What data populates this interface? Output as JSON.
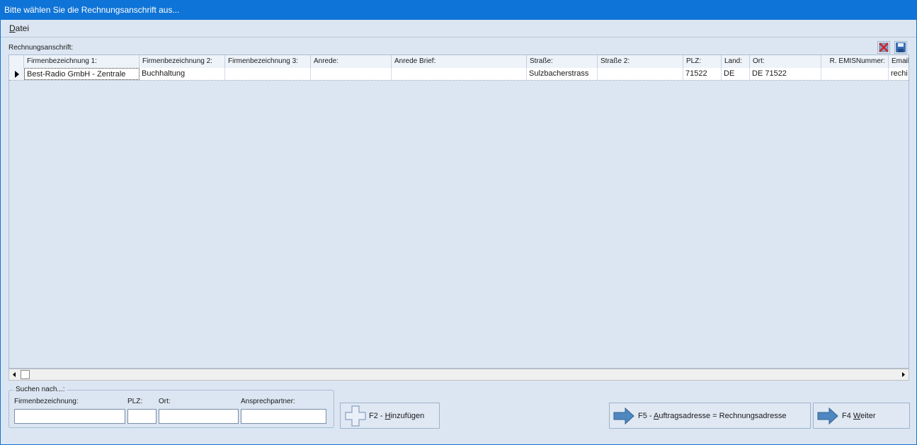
{
  "window": {
    "title": "Bitte wählen Sie die Rechnungsanschrift aus..."
  },
  "menu": {
    "datei": {
      "label_u": "D",
      "label_rest": "atei"
    }
  },
  "section": {
    "label": "Rechnungsanschrift:"
  },
  "grid": {
    "columns": [
      "Firmenbezeichnung 1:",
      "Firmenbezeichnung 2:",
      "Firmenbezeichnung 3:",
      "Anrede:",
      "Anrede Brief:",
      "Straße:",
      "Straße 2:",
      "PLZ:",
      "Land:",
      "Ort:",
      "R. EMISNummer:",
      "Email"
    ],
    "rows": [
      {
        "firma1": "Best-Radio GmbH - Zentrale",
        "firma2": "Buchhaltung",
        "firma3": "",
        "anrede": "",
        "anrede_brief": "",
        "strasse": "Sulzbacherstrass",
        "strasse2": "",
        "plz": "71522",
        "land": "DE",
        "ort": "DE 71522",
        "emis": "",
        "email": "rechi"
      }
    ]
  },
  "search": {
    "legend": "Suchen nach...:",
    "firma_label": "Firmenbezeichnung:",
    "plz_label": "PLZ:",
    "ort_label": "Ort:",
    "ansprech_label": "Ansprechpartner:",
    "firma_value": "",
    "plz_value": "",
    "ort_value": "",
    "ansprech_value": ""
  },
  "buttons": {
    "add": {
      "pre": "F2 - ",
      "u": "H",
      "post": "inzufügen"
    },
    "same_address": {
      "pre": "F5 - ",
      "u": "A",
      "post": "uftragsadresse = Rechnungsadresse"
    },
    "next": {
      "pre": "F4 ",
      "u": "W",
      "post": "eiter"
    }
  },
  "icons": {
    "delete": "delete-icon",
    "save": "save-icon",
    "add": "plus-icon",
    "arrow": "arrow-right-icon"
  },
  "colors": {
    "titlebar": "#0f74d7",
    "background": "#dce6f2"
  }
}
